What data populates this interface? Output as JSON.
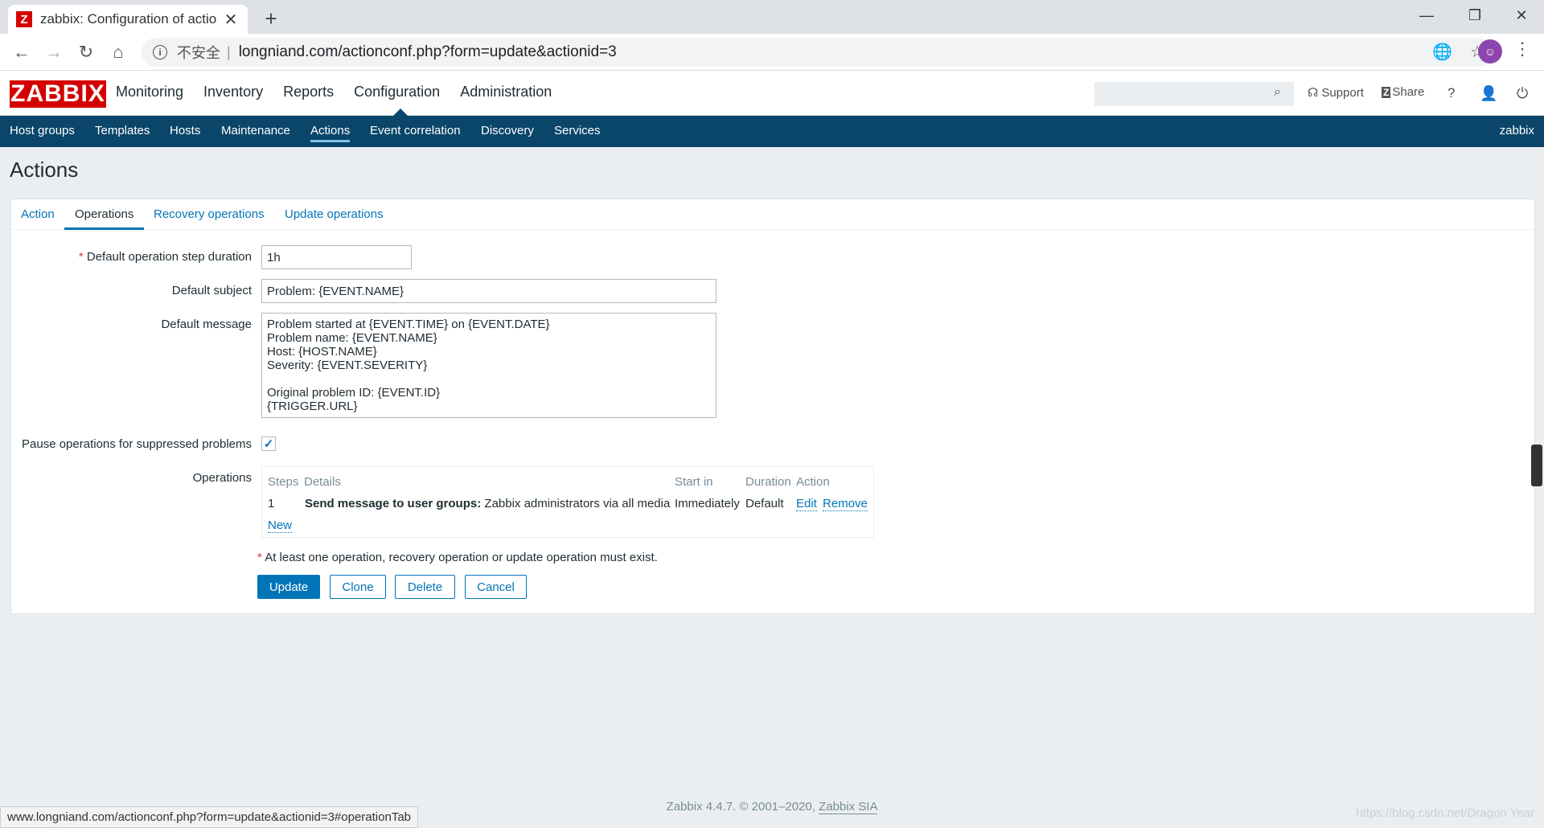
{
  "browser": {
    "tab_title": "zabbix: Configuration of actio",
    "favicon_letter": "Z",
    "omnibox_insecure": "不安全",
    "url": "longniand.com/actionconf.php?form=update&actionid=3",
    "status_url": "www.longniand.com/actionconf.php?form=update&actionid=3#operationTab"
  },
  "zabbix": {
    "logo": "ZABBIX",
    "main_menu": [
      "Monitoring",
      "Inventory",
      "Reports",
      "Configuration",
      "Administration"
    ],
    "header_links": {
      "support": "Support",
      "share": "Share",
      "help": "?"
    },
    "sub_menu": [
      "Host groups",
      "Templates",
      "Hosts",
      "Maintenance",
      "Actions",
      "Event correlation",
      "Discovery",
      "Services"
    ],
    "sub_menu_right": "zabbix"
  },
  "page": {
    "title": "Actions",
    "tabs": [
      "Action",
      "Operations",
      "Recovery operations",
      "Update operations"
    ],
    "form": {
      "step_duration_label": "Default operation step duration",
      "step_duration_value": "1h",
      "subject_label": "Default subject",
      "subject_value": "Problem: {EVENT.NAME}",
      "message_label": "Default message",
      "message_value": "Problem started at {EVENT.TIME} on {EVENT.DATE}\nProblem name: {EVENT.NAME}\nHost: {HOST.NAME}\nSeverity: {EVENT.SEVERITY}\n\nOriginal problem ID: {EVENT.ID}\n{TRIGGER.URL}",
      "pause_label": "Pause operations for suppressed problems",
      "operations_label": "Operations"
    },
    "operations_table": {
      "headers": {
        "steps": "Steps",
        "details": "Details",
        "start_in": "Start in",
        "duration": "Duration",
        "action": "Action"
      },
      "row": {
        "steps": "1",
        "details_bold": "Send message to user groups:",
        "details_rest": " Zabbix administrators via all media",
        "start_in": "Immediately",
        "duration": "Default",
        "edit": "Edit",
        "remove": "Remove"
      },
      "new_link": "New"
    },
    "note": "At least one operation, recovery operation or update operation must exist.",
    "buttons": {
      "update": "Update",
      "clone": "Clone",
      "delete": "Delete",
      "cancel": "Cancel"
    }
  },
  "footer": {
    "text": "Zabbix 4.4.7. © 2001–2020, ",
    "company": "Zabbix SIA"
  },
  "watermark": "https://blog.csdn.net/Dragon Year"
}
